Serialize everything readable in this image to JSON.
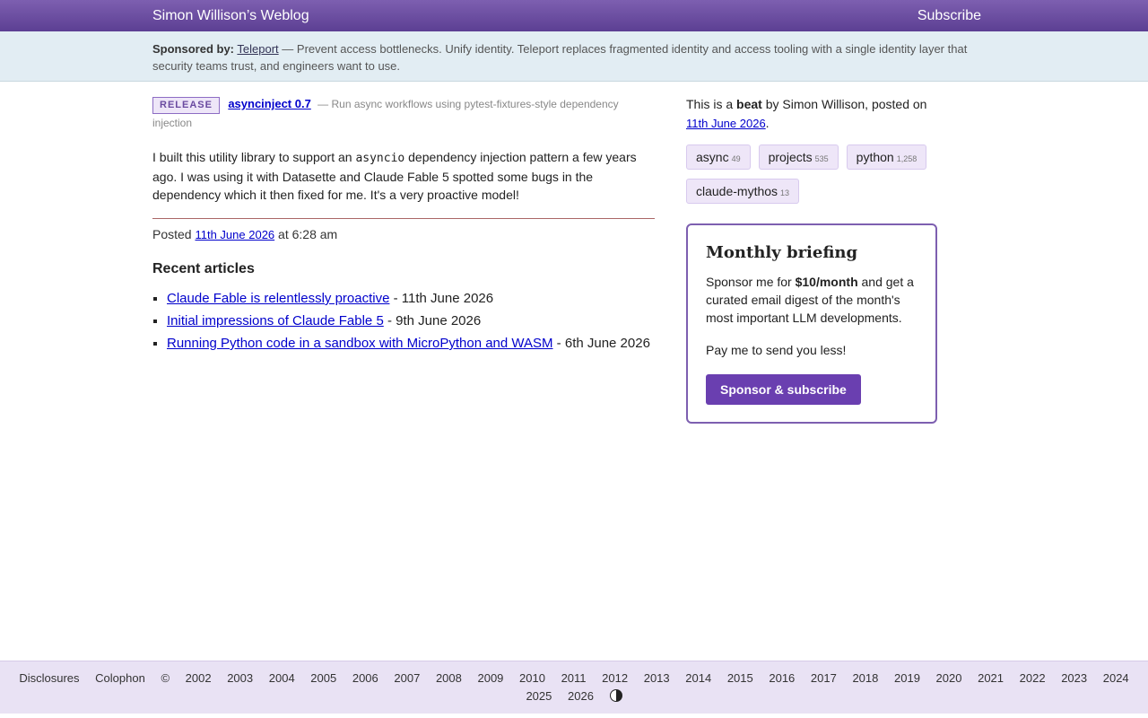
{
  "header": {
    "site_title": "Simon Willison’s Weblog",
    "subscribe": "Subscribe"
  },
  "sponsor": {
    "label": "Sponsored by:",
    "name": "Teleport",
    "text": "— Prevent access bottlenecks. Unify identity. Teleport replaces fragmented identity and access tooling with a single identity layer that security teams trust, and engineers want to use."
  },
  "release": {
    "badge": "RELEASE",
    "title": "asyncinject 0.7",
    "description": "— Run async workflows using pytest-fixtures-style dependency injection"
  },
  "body": {
    "part1": "I built this utility library to support an ",
    "code": "asyncio",
    "part2": " dependency injection pattern a few years ago. I was using it with Datasette and Claude Fable 5 spotted some bugs in the dependency which it then fixed for me. It's a very proactive model!"
  },
  "posted": {
    "prefix": "Posted ",
    "date": "11th June 2026",
    "time": " at 6:28 am"
  },
  "recent": {
    "heading": "Recent articles",
    "items": [
      {
        "title": "Claude Fable is relentlessly proactive",
        "date": " - 11th June 2026"
      },
      {
        "title": "Initial impressions of Claude Fable 5",
        "date": " - 9th June 2026"
      },
      {
        "title": "Running Python code in a sandbox with MicroPython and WASM",
        "date": " - 6th June 2026"
      }
    ]
  },
  "sidebar": {
    "beat_prefix": "This is a ",
    "beat_word": "beat",
    "beat_suffix": " by Simon Willison, posted on ",
    "beat_date": "11th June 2026",
    "beat_end": ".",
    "tags": [
      {
        "name": "async",
        "count": "49"
      },
      {
        "name": "projects",
        "count": "535"
      },
      {
        "name": "python",
        "count": "1,258"
      },
      {
        "name": "claude-mythos",
        "count": "13"
      }
    ]
  },
  "briefing": {
    "title": "Monthly briefing",
    "p1_prefix": "Sponsor me for ",
    "p1_price": "$10/month",
    "p1_suffix": " and get a curated email digest of the month's most important LLM developments.",
    "p2": "Pay me to send you less!",
    "button": "Sponsor & subscribe"
  },
  "footer": {
    "disclosures": "Disclosures",
    "colophon": "Colophon",
    "copyright": "©",
    "years": [
      "2002",
      "2003",
      "2004",
      "2005",
      "2006",
      "2007",
      "2008",
      "2009",
      "2010",
      "2011",
      "2012",
      "2013",
      "2014",
      "2015",
      "2016",
      "2017",
      "2018",
      "2019",
      "2020",
      "2021",
      "2022",
      "2023",
      "2024",
      "2025",
      "2026"
    ]
  },
  "colors": {
    "accent": "#6a3fb0",
    "header_bg": "#5c3f93",
    "sponsor_bg": "#e2edf3",
    "footer_bg": "#e9e2f4"
  }
}
